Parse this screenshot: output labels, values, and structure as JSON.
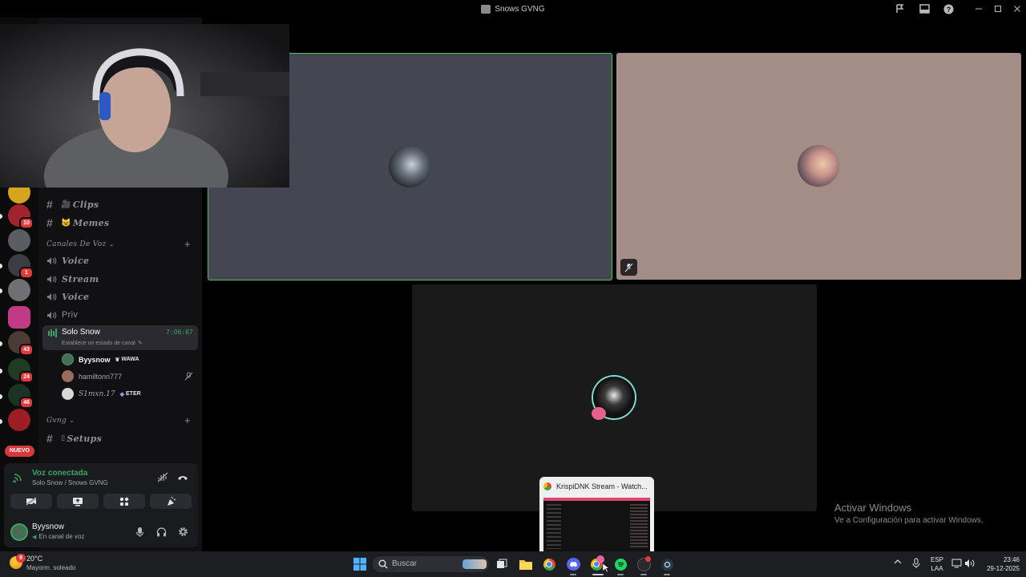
{
  "window": {
    "title": "Snows GVNG"
  },
  "rail": {
    "badges": [
      "10",
      "1",
      "43",
      "24",
      "46"
    ],
    "new_label": "NUEVO"
  },
  "channels": {
    "text": [
      {
        "name": "Clips",
        "emoji": "🎥"
      },
      {
        "name": "Memes",
        "emoji": "😺"
      }
    ],
    "voice_category": "Canales De Voz",
    "voice": [
      "Voice",
      "Stream",
      "Voice",
      "Priv"
    ],
    "active": {
      "name": "Solo Snow",
      "status": "Establece un estado de canal",
      "timer": "7:06:07"
    },
    "members": [
      {
        "name": "Byysnow",
        "tag": "WAWA"
      },
      {
        "name": "hamiltonn777",
        "tag": ""
      },
      {
        "name": "S1mxn.17",
        "tag": "ETER"
      }
    ],
    "gvng_category": "Gvng",
    "gvng_channel": "Setups"
  },
  "voice_panel": {
    "status": "Voz conectada",
    "location": "Solo Snow / Snows GVNG"
  },
  "user": {
    "name": "Byysnow",
    "status": "En canal de voz"
  },
  "watermark": {
    "title": "Activar Windows",
    "subtitle": "Ve a Configuración para activar Windows."
  },
  "thumbnail": {
    "title": "KrispiDNK Stream - Watch..."
  },
  "taskbar": {
    "weather_temp": "20°C",
    "weather_desc": "Mayorm. soleado",
    "weather_badge": "9",
    "search_placeholder": "Buscar",
    "lang": "ESP",
    "layout": "LAA",
    "time": "23:46",
    "date": "29-12-2025"
  },
  "colors": {
    "accent_green": "#3ba55d",
    "tile_border": "#53c05b",
    "badge_red": "#e23b3b"
  }
}
